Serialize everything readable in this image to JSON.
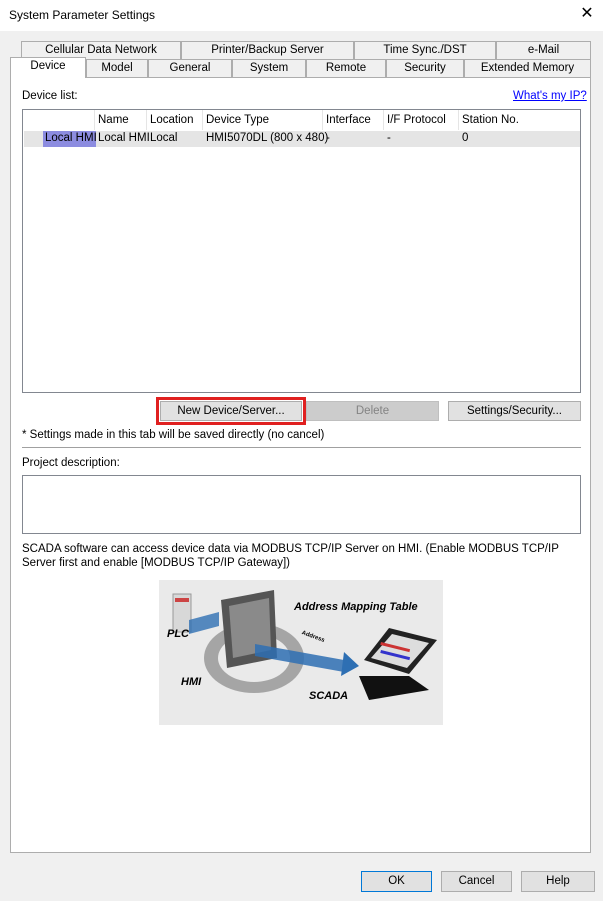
{
  "window": {
    "title": "System Parameter Settings",
    "close_label": "✕"
  },
  "tabs_row1": [
    "Cellular Data Network",
    "Printer/Backup Server",
    "Time Sync./DST",
    "e-Mail"
  ],
  "tabs_row2": [
    "Device",
    "Model",
    "General",
    "System",
    "Remote",
    "Security",
    "Extended Memory"
  ],
  "active_tab": "Device",
  "device_list": {
    "label": "Device list:",
    "link": "What's my IP?",
    "columns": [
      "",
      "Name",
      "Location",
      "Device Type",
      "Interface",
      "I/F Protocol",
      "Station No."
    ],
    "rows": [
      [
        "Local HMI",
        "Local HMI",
        "Local",
        "HMI5070DL (800 x 480)",
        "-",
        "-",
        "0"
      ]
    ]
  },
  "buttons": {
    "new_device": "New Device/Server...",
    "delete": "Delete",
    "settings": "Settings/Security..."
  },
  "note": "* Settings made in this tab will be saved directly (no cancel)",
  "project": {
    "label": "Project description:",
    "value": ""
  },
  "scada_text": "SCADA software can access device data via MODBUS TCP/IP Server on HMI. (Enable MODBUS TCP/IP Server first and enable [MODBUS TCP/IP Gateway])",
  "diagram": {
    "address_mapping": "Address Mapping Table",
    "plc": "PLC",
    "hmi": "HMI",
    "scada": "SCADA",
    "address": "Address"
  },
  "footer": {
    "ok": "OK",
    "cancel": "Cancel",
    "help": "Help"
  },
  "colors": {
    "selection": "#8c8ce0",
    "highlight": "#e02020",
    "link": "#0000ff"
  }
}
